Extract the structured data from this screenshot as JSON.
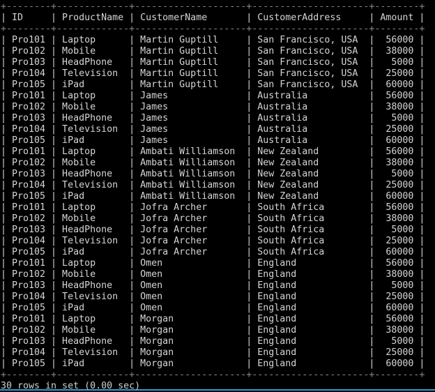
{
  "terminal": {
    "app": "mysql-client-terminal",
    "background_color": "#000000",
    "text_color": "#cfd0d0",
    "border_color": "#7f8a96",
    "accent_color": "#2e9fd4"
  },
  "table": {
    "columns": [
      {
        "key": "ID",
        "label": "ID",
        "width": 6,
        "align": "left"
      },
      {
        "key": "ProductName",
        "label": "ProductName",
        "width": 11,
        "align": "left"
      },
      {
        "key": "CustomerName",
        "label": "CustomerName",
        "width": 18,
        "align": "left"
      },
      {
        "key": "CustomerAddress",
        "label": "CustomerAddress",
        "width": 19,
        "align": "left"
      },
      {
        "key": "Amount",
        "label": "Amount",
        "width": 6,
        "align": "right"
      }
    ],
    "rows": [
      [
        "Pro101",
        "Laptop",
        "Martin Guptill",
        "San Francisco, USA",
        "56000"
      ],
      [
        "Pro102",
        "Mobile",
        "Martin Guptill",
        "San Francisco, USA",
        "38000"
      ],
      [
        "Pro103",
        "HeadPhone",
        "Martin Guptill",
        "San Francisco, USA",
        "5000"
      ],
      [
        "Pro104",
        "Television",
        "Martin Guptill",
        "San Francisco, USA",
        "25000"
      ],
      [
        "Pro105",
        "iPad",
        "Martin Guptill",
        "San Francisco, USA",
        "60000"
      ],
      [
        "Pro101",
        "Laptop",
        "James",
        "Australia",
        "56000"
      ],
      [
        "Pro102",
        "Mobile",
        "James",
        "Australia",
        "38000"
      ],
      [
        "Pro103",
        "HeadPhone",
        "James",
        "Australia",
        "5000"
      ],
      [
        "Pro104",
        "Television",
        "James",
        "Australia",
        "25000"
      ],
      [
        "Pro105",
        "iPad",
        "James",
        "Australia",
        "60000"
      ],
      [
        "Pro101",
        "Laptop",
        "Ambati Williamson",
        "New Zealand",
        "56000"
      ],
      [
        "Pro102",
        "Mobile",
        "Ambati Williamson",
        "New Zealand",
        "38000"
      ],
      [
        "Pro103",
        "HeadPhone",
        "Ambati Williamson",
        "New Zealand",
        "5000"
      ],
      [
        "Pro104",
        "Television",
        "Ambati Williamson",
        "New Zealand",
        "25000"
      ],
      [
        "Pro105",
        "iPad",
        "Ambati Williamson",
        "New Zealand",
        "60000"
      ],
      [
        "Pro101",
        "Laptop",
        "Jofra Archer",
        "South Africa",
        "56000"
      ],
      [
        "Pro102",
        "Mobile",
        "Jofra Archer",
        "South Africa",
        "38000"
      ],
      [
        "Pro103",
        "HeadPhone",
        "Jofra Archer",
        "South Africa",
        "5000"
      ],
      [
        "Pro104",
        "Television",
        "Jofra Archer",
        "South Africa",
        "25000"
      ],
      [
        "Pro105",
        "iPad",
        "Jofra Archer",
        "South Africa",
        "60000"
      ],
      [
        "Pro101",
        "Laptop",
        "Omen",
        "England",
        "56000"
      ],
      [
        "Pro102",
        "Mobile",
        "Omen",
        "England",
        "38000"
      ],
      [
        "Pro103",
        "HeadPhone",
        "Omen",
        "England",
        "5000"
      ],
      [
        "Pro104",
        "Television",
        "Omen",
        "England",
        "25000"
      ],
      [
        "Pro105",
        "iPad",
        "Omen",
        "England",
        "60000"
      ],
      [
        "Pro101",
        "Laptop",
        "Morgan",
        "England",
        "56000"
      ],
      [
        "Pro102",
        "Mobile",
        "Morgan",
        "England",
        "38000"
      ],
      [
        "Pro103",
        "HeadPhone",
        "Morgan",
        "England",
        "5000"
      ],
      [
        "Pro104",
        "Television",
        "Morgan",
        "England",
        "25000"
      ],
      [
        "Pro105",
        "iPad",
        "Morgan",
        "England",
        "60000"
      ]
    ]
  },
  "status": {
    "result_line": "30 rows in set (0.00 sec)",
    "row_count": 30,
    "elapsed_seconds": "0.00"
  }
}
